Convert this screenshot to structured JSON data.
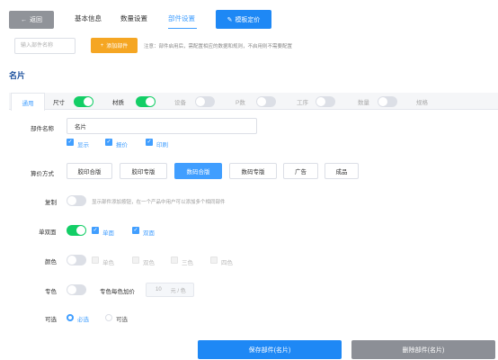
{
  "topbar": {
    "back_label": "返回",
    "tabs": [
      {
        "label": "基本信息"
      },
      {
        "label": "数量设置"
      },
      {
        "label": "部件设置"
      }
    ],
    "template_button_label": "模板定价"
  },
  "toolbar": {
    "name_placeholder": "输入部件名称",
    "add_button_label": "添加部件",
    "note": "注意：部件启用后，需配置相应的数据和规则，不启用则不需要配置"
  },
  "section_title": "名片",
  "tabstrip": {
    "active_tab": "通用",
    "items": [
      {
        "label": "尺寸",
        "toggle_on": true
      },
      {
        "label": "材质",
        "toggle_on": true
      },
      {
        "label": "设备",
        "toggle_on": false
      },
      {
        "label": "P数",
        "toggle_on": false
      },
      {
        "label": "工序",
        "toggle_on": false
      },
      {
        "label": "数量",
        "toggle_on": false
      },
      {
        "label": "规格"
      }
    ]
  },
  "form": {
    "part_name_label": "部件名称",
    "part_name_value": "名片",
    "display_checks": [
      {
        "label": "显示",
        "checked": true
      },
      {
        "label": "报价",
        "checked": true
      },
      {
        "label": "印刷",
        "checked": true
      }
    ],
    "pricing_label": "算价方式",
    "pricing_options": [
      {
        "label": "胶印合版",
        "active": false
      },
      {
        "label": "胶印专版",
        "active": false
      },
      {
        "label": "数码合版",
        "active": true
      },
      {
        "label": "数码专版",
        "active": false
      },
      {
        "label": "广告",
        "active": false
      },
      {
        "label": "成品",
        "active": false
      }
    ],
    "copy_label": "复制",
    "copy_hint": "显示部件添加按钮，在一个产品中用户可以添加多个相同部件",
    "duplex_label": "单双面",
    "duplex_options": [
      {
        "label": "单面",
        "checked": true
      },
      {
        "label": "双面",
        "checked": true
      }
    ],
    "color_label": "颜色",
    "color_options": [
      {
        "label": "单色"
      },
      {
        "label": "双色"
      },
      {
        "label": "三色"
      },
      {
        "label": "四色"
      }
    ],
    "spot_label": "专色",
    "spot_price_label": "专色每色加价",
    "spot_price_value": "10",
    "spot_price_unit": "元 / 色",
    "optional_label": "可选",
    "optional_options": [
      {
        "label": "必选",
        "selected": true
      },
      {
        "label": "可选",
        "selected": false
      }
    ]
  },
  "footer": {
    "save_label": "保存部件(名片)",
    "delete_label": "删除部件(名片)"
  },
  "colors": {
    "primary": "#409eff",
    "primary_dark": "#1e88f5",
    "success": "#13ce66",
    "warning": "#f5a623",
    "title": "#1a4f9c"
  }
}
